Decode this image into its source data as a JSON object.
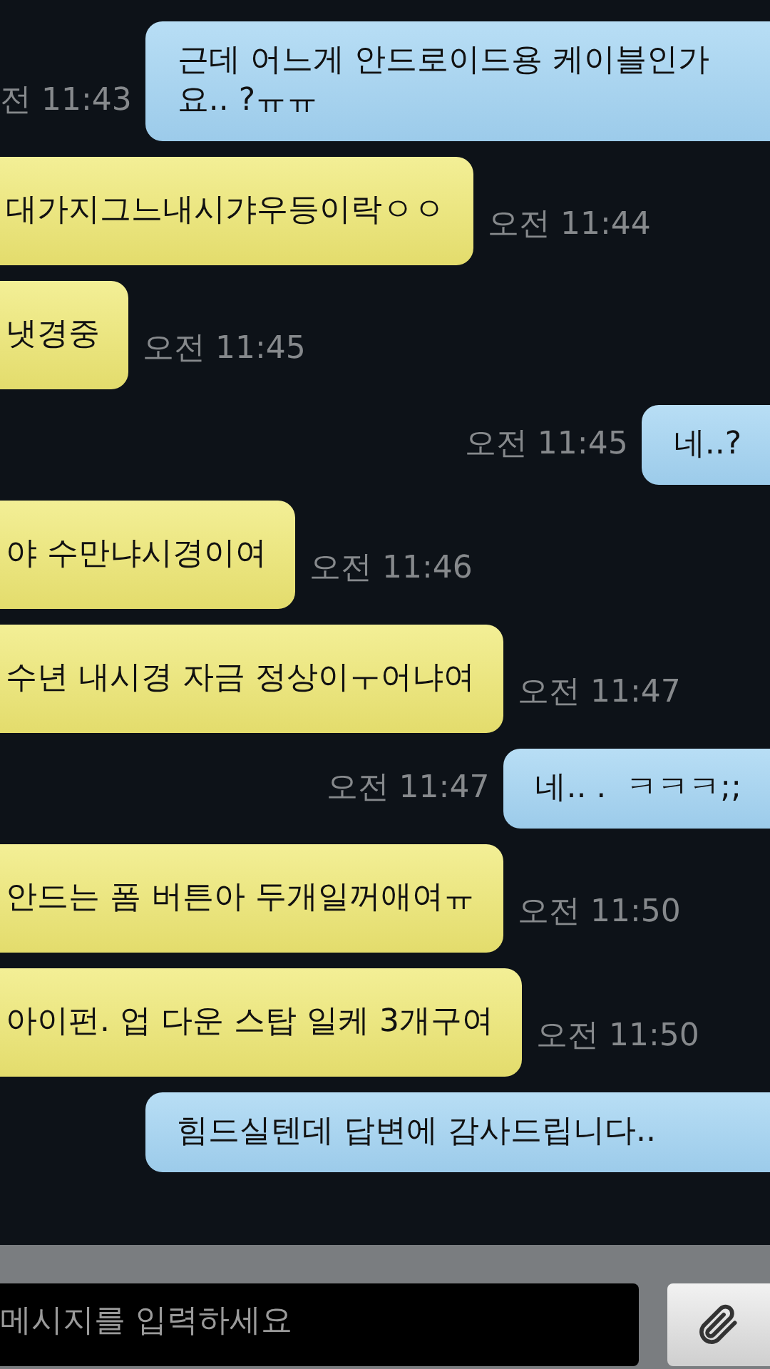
{
  "messages": [
    {
      "kind": "sent",
      "text": "근데 어느게 안드로이드용 케이블인가요.. ?ㅠㅠ",
      "time": "전 11:43"
    },
    {
      "kind": "received",
      "text": "대가지그느내시갸우등이락ㅇㅇ",
      "time": "오전 11:44"
    },
    {
      "kind": "received",
      "text": "냇경중",
      "time": "오전 11:45"
    },
    {
      "kind": "sent",
      "text": "네..?",
      "time": "오전 11:45"
    },
    {
      "kind": "received",
      "text": "야 수만냐시경이여",
      "time": "오전 11:46"
    },
    {
      "kind": "received",
      "text": "수년 내시경 자금 정상이ㅜ어냐여",
      "time": "오전 11:47"
    },
    {
      "kind": "sent",
      "text": "네.. .  ㅋㅋㅋ;;",
      "time": "오전 11:47"
    },
    {
      "kind": "received",
      "text": "안드는 폼 버튼아 두개일꺼애여ㅠ",
      "time": "오전 11:50"
    },
    {
      "kind": "received",
      "text": "아이펀. 업 다운 스탑 일케 3개구여",
      "time": "오전 11:50"
    },
    {
      "kind": "sent",
      "text": "힘드실텐데 답변에 감사드립니다.."
    }
  ],
  "composer": {
    "placeholder": "메시지를 입력하세요"
  }
}
